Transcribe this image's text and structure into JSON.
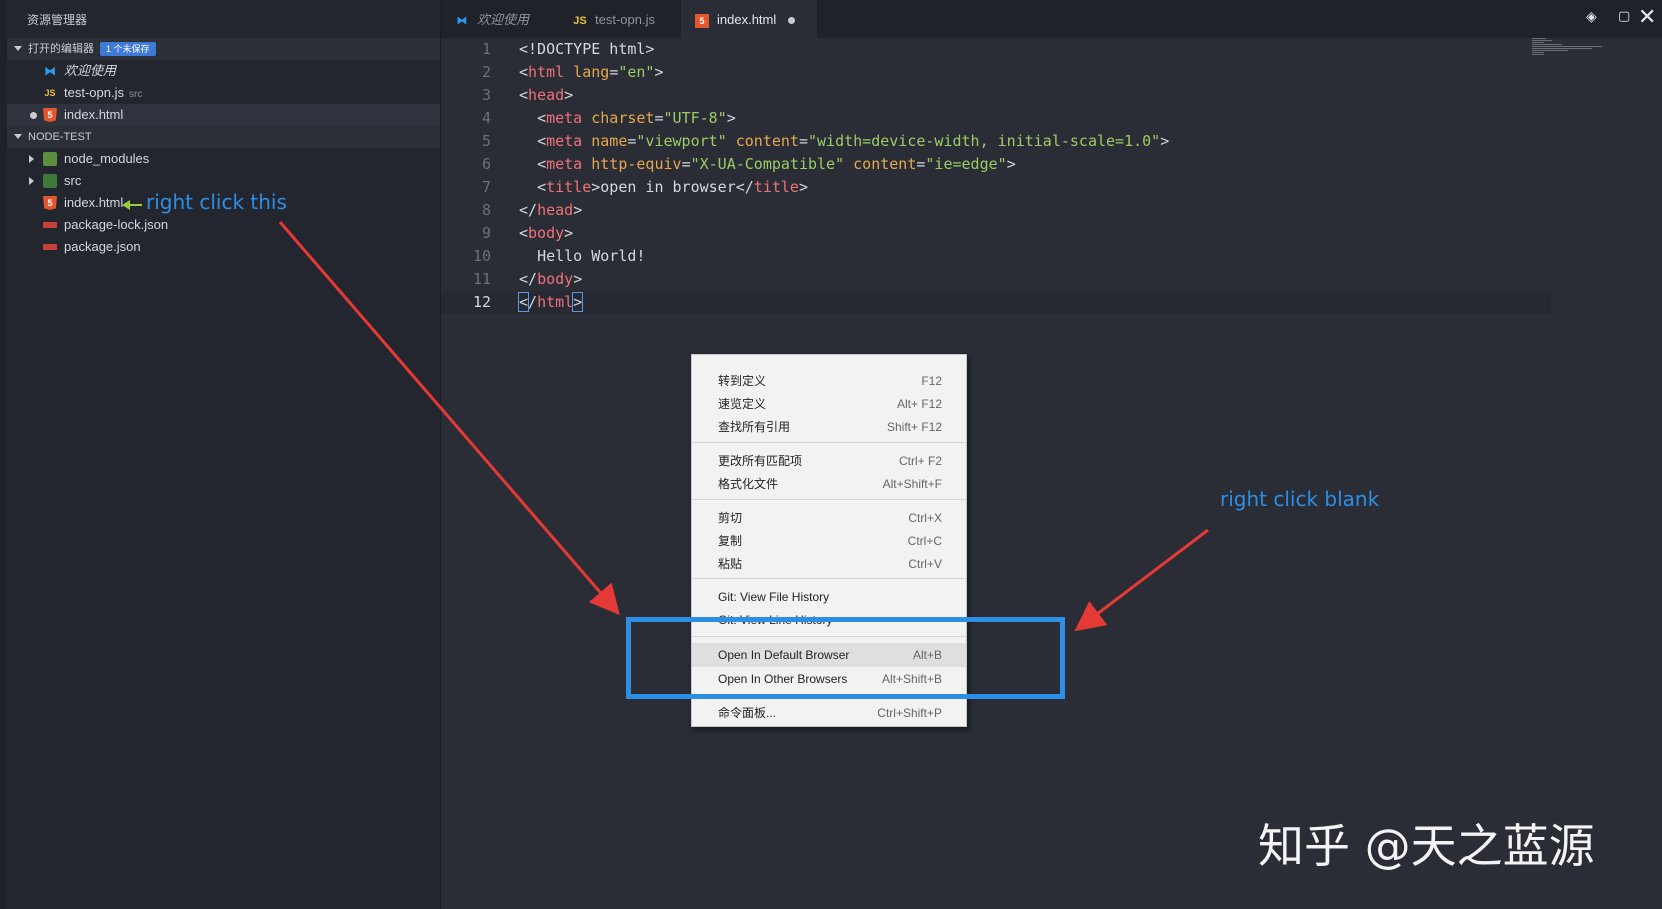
{
  "sidebar": {
    "title": "资源管理器",
    "open_editors": {
      "label": "打开的编辑器",
      "badge": "1 个未保存",
      "items": [
        {
          "name": "欢迎使用",
          "icon": "vscode-icon"
        },
        {
          "name": "test-opn.js",
          "sub": "src",
          "icon": "js-icon"
        },
        {
          "name": "index.html",
          "icon": "html-icon",
          "unsaved": true
        }
      ]
    },
    "project": {
      "label": "NODE-TEST",
      "items": [
        {
          "name": "node_modules",
          "icon": "node-folder-icon",
          "type": "folder"
        },
        {
          "name": "src",
          "icon": "src-folder-icon",
          "type": "folder"
        },
        {
          "name": "index.html",
          "icon": "html-icon",
          "type": "file"
        },
        {
          "name": "package-lock.json",
          "icon": "npm-icon",
          "type": "file"
        },
        {
          "name": "package.json",
          "icon": "npm-icon",
          "type": "file"
        }
      ]
    }
  },
  "tabs": [
    {
      "label": "欢迎使用",
      "icon": "vscode-icon"
    },
    {
      "label": "test-opn.js",
      "icon": "js-icon"
    },
    {
      "label": "index.html",
      "icon": "html-icon",
      "active": true,
      "unsaved": true
    }
  ],
  "editor": {
    "line_numbers": [
      "1",
      "2",
      "3",
      "4",
      "5",
      "6",
      "7",
      "8",
      "9",
      "10",
      "11",
      "12"
    ],
    "current_line": 12
  },
  "context_menu": {
    "items": [
      {
        "label": "转到定义",
        "key": "F12"
      },
      {
        "label": "速览定义",
        "key": "Alt+ F12"
      },
      {
        "label": "查找所有引用",
        "key": "Shift+ F12"
      },
      {
        "label": "更改所有匹配项",
        "key": "Ctrl+ F2"
      },
      {
        "label": "格式化文件",
        "key": "Alt+Shift+F"
      },
      {
        "label": "剪切",
        "key": "Ctrl+X"
      },
      {
        "label": "复制",
        "key": "Ctrl+C"
      },
      {
        "label": "粘贴",
        "key": "Ctrl+V"
      },
      {
        "label": "Git: View File History",
        "key": ""
      },
      {
        "label": "Git: View Line History",
        "key": ""
      },
      {
        "label": "Open In Default Browser",
        "key": "Alt+B"
      },
      {
        "label": "Open In Other Browsers",
        "key": "Alt+Shift+B"
      },
      {
        "label": "命令面板...",
        "key": "Ctrl+Shift+P"
      }
    ]
  },
  "annotations": {
    "right_click_this": "right click this",
    "right_click_blank": "right click blank",
    "watermark": "知乎 @天之蓝源",
    "arrow_color": "#e53935",
    "highlight_color": "#2d8ee6"
  }
}
